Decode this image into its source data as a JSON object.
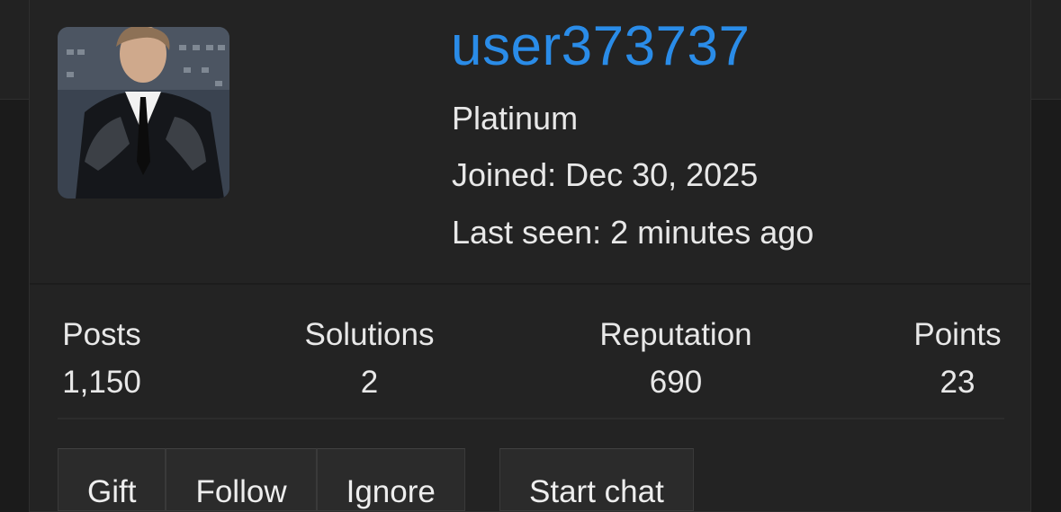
{
  "profile": {
    "username": "user373737",
    "rank": "Platinum",
    "joined": "Joined: Dec 30, 2025",
    "last_seen": "Last seen: 2 minutes ago"
  },
  "stats": [
    {
      "label": "Posts",
      "value": "1,150"
    },
    {
      "label": "Solutions",
      "value": "2"
    },
    {
      "label": "Reputation",
      "value": "690"
    },
    {
      "label": "Points",
      "value": "23"
    }
  ],
  "actions": {
    "gift": "Gift",
    "follow": "Follow",
    "ignore": "Ignore",
    "start_chat": "Start chat"
  },
  "colors": {
    "username": "#2a8ce8",
    "card_bg": "#232323",
    "page_bg": "#1b1b1b"
  }
}
